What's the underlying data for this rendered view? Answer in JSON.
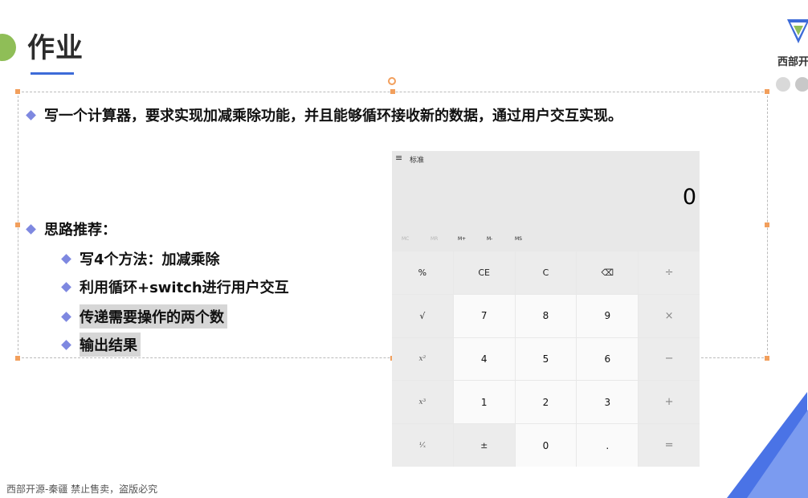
{
  "slide": {
    "title": "作业",
    "logo_text": "西部开"
  },
  "content": {
    "task": "写一个计算器，要求实现加减乘除功能，并且能够循环接收新的数据，通过用户交互实现。",
    "hint_header": "思路推荐：",
    "hints": [
      "写4个方法：加减乘除",
      "利用循环+switch进行用户交互",
      "传递需要操作的两个数",
      "输出结果"
    ]
  },
  "calculator": {
    "menu_icon": "≡",
    "mode": "标准",
    "display": "0",
    "memory": [
      "MC",
      "MR",
      "M+",
      "M-",
      "MS"
    ],
    "keys": [
      [
        "%",
        "CE",
        "C",
        "⌫",
        "÷"
      ],
      [
        "√",
        "7",
        "8",
        "9",
        "×"
      ],
      [
        "x²",
        "4",
        "5",
        "6",
        "−"
      ],
      [
        "x³",
        "1",
        "2",
        "3",
        "+"
      ],
      [
        "¹⁄ₓ",
        "±",
        "0",
        ".",
        "="
      ]
    ]
  },
  "footer": {
    "text": "西部开源-秦疆    禁止售卖，盗版必究"
  },
  "colors": {
    "accent": "#3d6bd8",
    "bullet": "#7e88e0",
    "handle": "#f29f5c",
    "title_dot": "#8fbe57"
  }
}
